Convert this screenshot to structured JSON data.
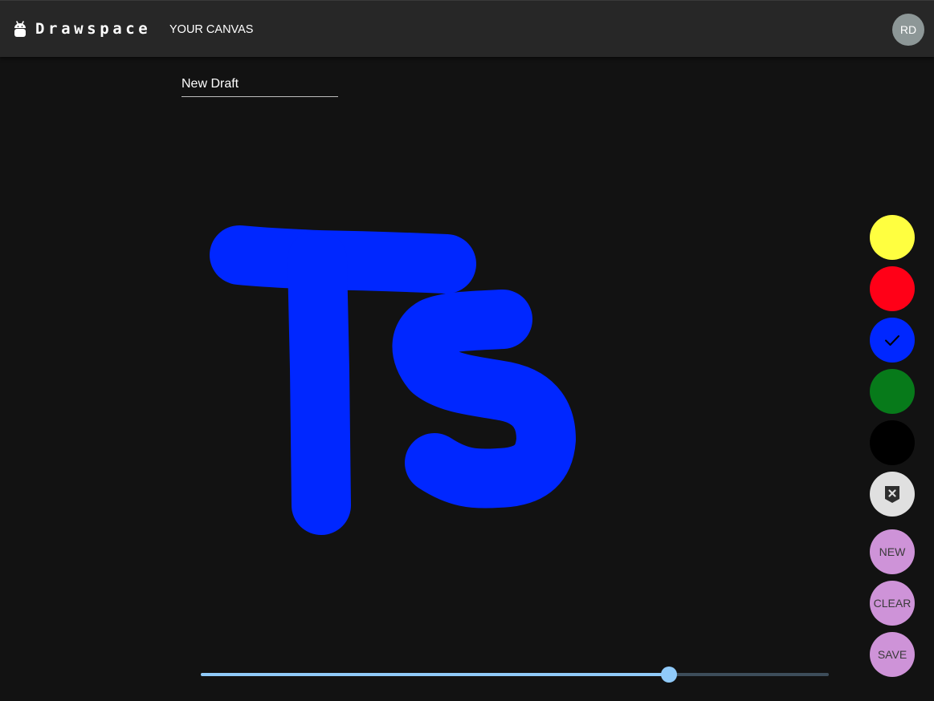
{
  "header": {
    "brand": "Drawspace",
    "nav_link": "YOUR CANVAS",
    "avatar_initials": "RD"
  },
  "drawing": {
    "title_value": "New Draft",
    "stroke_color": "#0027ff",
    "canvas_background": "#121212"
  },
  "palette": {
    "colors": [
      {
        "name": "yellow",
        "hex": "#ffff40"
      },
      {
        "name": "red",
        "hex": "#ff0017"
      },
      {
        "name": "blue",
        "hex": "#0027ff",
        "selected": true
      },
      {
        "name": "green",
        "hex": "#077a1a"
      },
      {
        "name": "black",
        "hex": "#000000"
      }
    ],
    "eraser_icon": "eraser-icon",
    "check_icon": "check-icon"
  },
  "actions": {
    "new_label": "NEW",
    "clear_label": "CLEAR",
    "save_label": "SAVE"
  },
  "brush_size": {
    "value_fraction": 0.74,
    "accent": "#90caf9"
  }
}
